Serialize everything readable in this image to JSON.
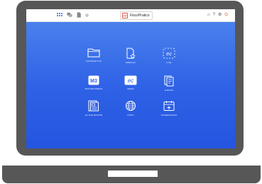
{
  "toolbar": {
    "brand_logo_text": "FP",
    "brand_name": "FiscoPratico",
    "right_icons": [
      "bell-icon",
      "help-icon",
      "settings-icon",
      "power-icon"
    ]
  },
  "tiles": [
    {
      "label": "CONTENUTI DI",
      "icon": "folder-icon"
    },
    {
      "label": "SPECIALI",
      "icon": "document-star-icon"
    },
    {
      "label": "LIVE",
      "icon": "live-icon"
    },
    {
      "label": "MASTER BREVE",
      "icon": "mb-icon"
    },
    {
      "label": "NEWS",
      "icon": "news-icon"
    },
    {
      "label": "E-BOOK",
      "icon": "ebook-icon"
    },
    {
      "label": "LE SUE RIVISTE",
      "icon": "magazine-icon"
    },
    {
      "label": "FONTI",
      "icon": "globe-icon"
    },
    {
      "label": "SCADENZARIO",
      "icon": "calendar-icon"
    }
  ],
  "colors": {
    "screen_top": "#4f87ee",
    "screen_bottom": "#2455e0",
    "frame": "#575757",
    "brand_accent": "#e05a4a"
  }
}
